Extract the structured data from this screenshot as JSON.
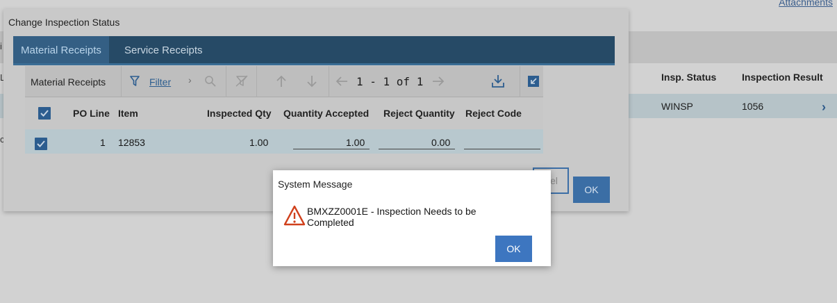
{
  "background": {
    "top_link": "Attachments",
    "columns": [
      "Insp. Status",
      "Inspection Result"
    ],
    "row": {
      "insp_status": "WINSP",
      "inspection_result": "1056"
    },
    "left_fragment_1": "i",
    "left_fragment_2": "L",
    "left_fragment_3": "c"
  },
  "dialog": {
    "title": "Change Inspection Status",
    "tabs": [
      {
        "label": "Material Receipts",
        "active": true
      },
      {
        "label": "Service Receipts",
        "active": false
      }
    ],
    "table": {
      "title": "Material Receipts",
      "filter_label": "Filter",
      "pager": "1 - 1 of 1",
      "columns": [
        "PO Line",
        "Item",
        "Inspected Qty",
        "Quantity Accepted",
        "Reject Quantity",
        "Reject Code"
      ],
      "rows": [
        {
          "po_line": "1",
          "item": "12853",
          "inspected_qty": "1.00",
          "quantity_accepted": "1.00",
          "reject_quantity": "0.00",
          "reject_code": ""
        }
      ]
    },
    "cancel_label": "el",
    "ok_label": "OK"
  },
  "system_message": {
    "title": "System Message",
    "text": "BMXZZ0001E - Inspection Needs to be Completed",
    "ok_label": "OK",
    "icon": "warning-icon"
  },
  "colors": {
    "tab_bar": "#264a66",
    "active_tab": "#345f84",
    "primary_button": "#3d76c0",
    "warning": "#d0401c"
  }
}
